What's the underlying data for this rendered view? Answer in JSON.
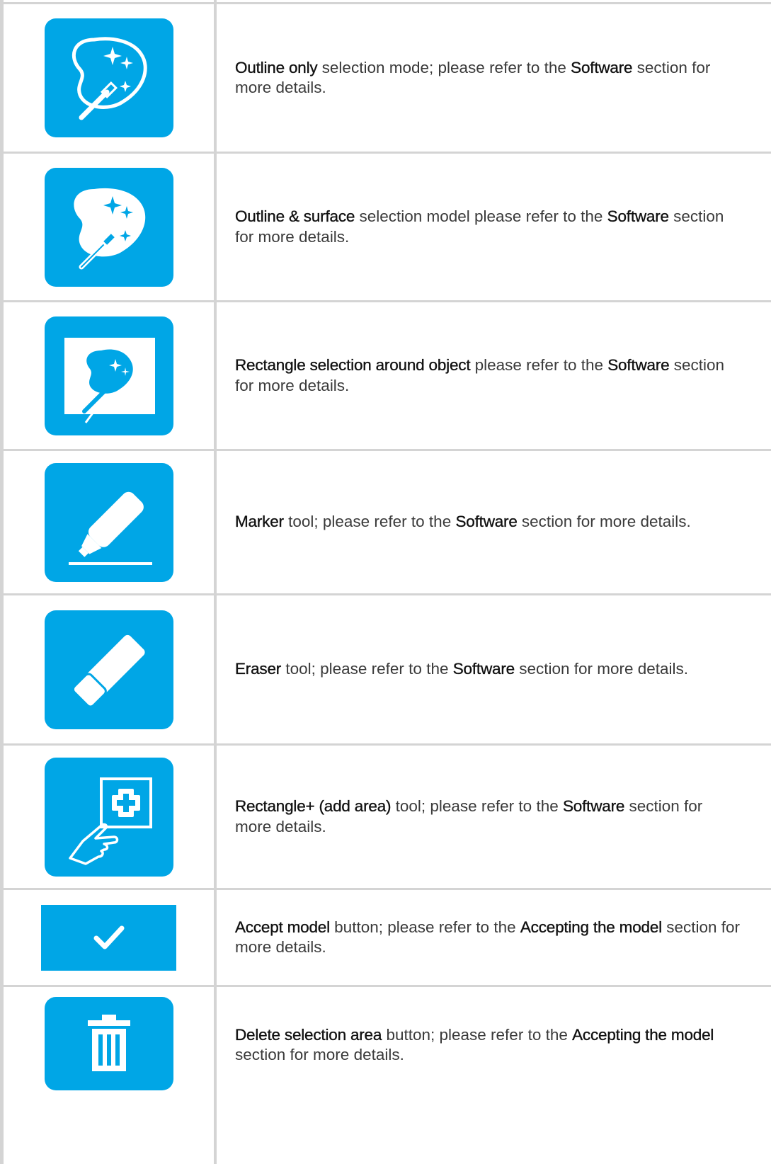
{
  "rows": [
    {
      "icon": "outline-only-selection-icon",
      "bold1": "Outline only",
      "text1": " selection mode; please refer to the ",
      "bold2": "Software",
      "text2": " section for more details."
    },
    {
      "icon": "outline-surface-selection-icon",
      "bold1": "Outline & surface",
      "text1": " selection model please refer to the ",
      "bold2": "Software",
      "text2": " section for more details."
    },
    {
      "icon": "rectangle-selection-icon",
      "bold1": "Rectangle selection around object",
      "text1": " please refer to the ",
      "bold2": "Software",
      "text2": " section for more details."
    },
    {
      "icon": "marker-icon",
      "bold1": "Marker",
      "text1": " tool; please refer to the ",
      "bold2": "Software",
      "text2": " section for more details."
    },
    {
      "icon": "eraser-icon",
      "bold1": "Eraser",
      "text1": " tool; please refer to the ",
      "bold2": "Software",
      "text2": " section for more details."
    },
    {
      "icon": "rectangle-add-area-icon",
      "bold1": "Rectangle+ (add area)",
      "text1": " tool; please refer to the ",
      "bold2": "Software",
      "text2": " section for more details."
    },
    {
      "icon": "checkmark-icon",
      "bold1": "Accept model",
      "text1": " button; please refer to the ",
      "bold2": "Accepting the model",
      "text2": " section for more details."
    },
    {
      "icon": "trash-icon",
      "bold1": "Delete selection area",
      "text1": " button; please refer to the ",
      "bold2": "Accepting the model",
      "text2": " section for more details."
    }
  ],
  "colors": {
    "accent": "#00a6e6",
    "border": "#d4d4d4",
    "text": "#3a3a3a"
  }
}
